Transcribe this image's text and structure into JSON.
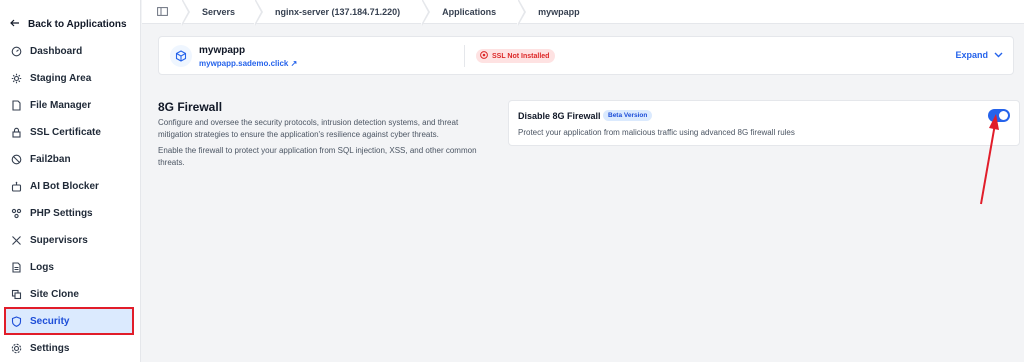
{
  "sidebar": {
    "back_label": "Back to Applications",
    "items": [
      {
        "label": "Dashboard",
        "icon": "gauge-icon"
      },
      {
        "label": "Staging Area",
        "icon": "gear-staging-icon"
      },
      {
        "label": "File Manager",
        "icon": "file-icon"
      },
      {
        "label": "SSL Certificate",
        "icon": "lock-icon"
      },
      {
        "label": "Fail2ban",
        "icon": "ban-icon"
      },
      {
        "label": "AI Bot Blocker",
        "icon": "robot-icon"
      },
      {
        "label": "PHP Settings",
        "icon": "php-settings-icon"
      },
      {
        "label": "Supervisors",
        "icon": "tools-icon"
      },
      {
        "label": "Logs",
        "icon": "logs-icon"
      },
      {
        "label": "Site Clone",
        "icon": "clone-icon"
      },
      {
        "label": "Security",
        "icon": "shield-icon",
        "active": true
      },
      {
        "label": "Settings",
        "icon": "gear-icon"
      }
    ]
  },
  "breadcrumb": {
    "items": [
      "Servers",
      "nginx-server (137.184.71.220)",
      "Applications",
      "mywpapp"
    ]
  },
  "app": {
    "name": "mywpapp",
    "link": "mywpapp.sademo.click",
    "ssl_status": "SSL Not Installed",
    "expand_label": "Expand"
  },
  "firewall": {
    "section_title": "8G Firewall",
    "description": "Configure and oversee the security protocols, intrusion detection systems, and threat mitigation strategies to ensure the application's resilience against cyber threats.",
    "description2": "Enable the firewall to protect your application from SQL injection, XSS, and other common threats.",
    "card_title": "Disable 8G Firewall",
    "badge": "Beta Version",
    "card_desc": "Protect your application from malicious traffic using advanced 8G firewall rules",
    "enabled": true
  },
  "colors": {
    "accent": "#2563eb",
    "active_bg": "#dbeafe",
    "danger": "#dc2626",
    "highlight": "#e11d2a"
  }
}
